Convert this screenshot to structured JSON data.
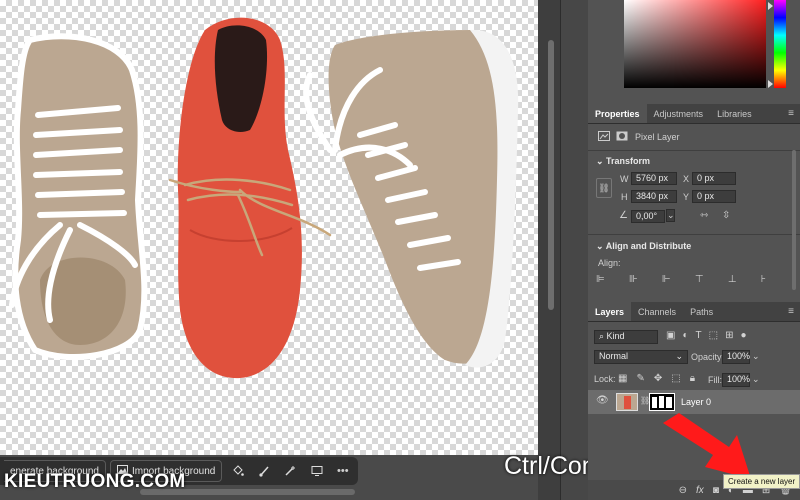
{
  "taskbar": {
    "generate_label": "enerate background",
    "import_label": "Import background",
    "icons": [
      "paint-bucket-icon",
      "brush-icon",
      "brush-plus-icon",
      "adjust-icon",
      "more-icon"
    ],
    "more_glyph": "•••"
  },
  "overlay": {
    "watermark": "KIEUTRUONG.COM",
    "shortcut": "Ctrl/Command"
  },
  "properties": {
    "tabs": [
      "Properties",
      "Adjustments",
      "Libraries"
    ],
    "layer_type": "Pixel Layer",
    "transform_title": "Transform",
    "w_label": "W",
    "w_value": "5760 px",
    "h_label": "H",
    "h_value": "3840 px",
    "x_label": "X",
    "x_value": "0 px",
    "y_label": "Y",
    "y_value": "0 px",
    "angle_value": "0,00°",
    "align_title": "Align and Distribute",
    "align_label": "Align:"
  },
  "layers": {
    "tabs": [
      "Layers",
      "Channels",
      "Paths"
    ],
    "filter_kind": "Kind",
    "blend_mode": "Normal",
    "opacity_label": "Opacity:",
    "opacity_value": "100%",
    "lock_label": "Lock:",
    "fill_label": "Fill:",
    "fill_value": "100%",
    "layer_name": "Layer 0",
    "tooltip": "Create a new layer"
  },
  "colors": {
    "accent_arrow": "#ff1a1a",
    "panel_bg": "#535353",
    "selected_layer": "#6c6c6c",
    "shoe_red": "#e0513d",
    "shoe_beige": "#bba791"
  }
}
